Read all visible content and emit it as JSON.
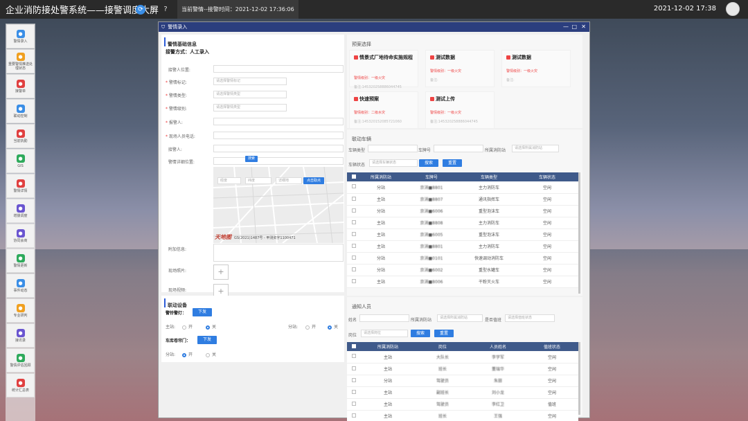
{
  "topbar": {
    "title": "企业消防接处警系统——接警调度大屏",
    "alarm_text": "当前警情--接警时间：2021-12-02 17:36:06",
    "datetime": "2021-12-02 17:38",
    "icons": [
      "refresh-icon",
      "wave-icon",
      "help-icon"
    ]
  },
  "sidebar": {
    "items": [
      {
        "label": "警情录入",
        "color": "#3a8ee6",
        "icon": "pencil-icon"
      },
      {
        "label": "重要警情推送处理状态",
        "color": "#f0a020",
        "icon": "bell-icon"
      },
      {
        "label": "接警单",
        "color": "#e04040",
        "icon": "alert-icon"
      },
      {
        "label": "联动控制",
        "color": "#3a8ee6",
        "icon": "link-icon"
      },
      {
        "label": "当前执勤",
        "color": "#e04040",
        "icon": "duty-icon"
      },
      {
        "label": "GIS",
        "color": "#2eaa5c",
        "icon": "pin-icon"
      },
      {
        "label": "警情详情",
        "color": "#e04040",
        "icon": "detail-icon"
      },
      {
        "label": "增援调度",
        "color": "#6a55d0",
        "icon": "dispatch-icon"
      },
      {
        "label": "协同会商",
        "color": "#6a55d0",
        "icon": "meeting-icon"
      },
      {
        "label": "警情更新",
        "color": "#2eaa5c",
        "icon": "update-icon"
      },
      {
        "label": "事件动态",
        "color": "#3a8ee6",
        "icon": "event-icon"
      },
      {
        "label": "专业研判",
        "color": "#f0a020",
        "icon": "study-icon"
      },
      {
        "label": "接讯录",
        "color": "#6a55d0",
        "icon": "contact-icon"
      },
      {
        "label": "警情评估回顾",
        "color": "#2eaa5c",
        "icon": "review-icon"
      },
      {
        "label": "统计汇总表",
        "color": "#e04040",
        "icon": "stats-icon"
      }
    ]
  },
  "dialog": {
    "title": "警情录入",
    "controls": [
      "—",
      "□",
      "✕"
    ],
    "basic": {
      "section": "警情基础信息",
      "method": "接警方式：人工录入",
      "fields": [
        {
          "label": "接警人位置:",
          "required": false,
          "placeholder": ""
        },
        {
          "label": "警情标记:",
          "required": true,
          "placeholder": "请选择警情标记"
        },
        {
          "label": "警情类型:",
          "required": true,
          "placeholder": "请选择警情类型"
        },
        {
          "label": "警情级别:",
          "required": true,
          "placeholder": "请选择警情类型"
        },
        {
          "label": "报警人:",
          "required": true,
          "placeholder": ""
        },
        {
          "label": "现场人员电话:",
          "required": true,
          "placeholder": ""
        },
        {
          "label": "接警人:",
          "required": false,
          "placeholder": ""
        },
        {
          "label": "警情详细位置:",
          "required": false,
          "placeholder": ""
        }
      ],
      "search_btn": "搜索",
      "map_inputs": [
        "经度",
        "纬度",
        "详细地"
      ],
      "map_click_btn": "点击取点",
      "map_logo": "天地图",
      "map_license": "GS(2021)1487号 - 甲测资字1100471",
      "extra_label": "附加信息:",
      "photo_label": "现场照片:",
      "video_label": "现场视频:"
    },
    "devices": {
      "section": "联动设备",
      "alarm_bell": "警铃警灯：",
      "issue_btn": "下发",
      "main_station": "主站:",
      "sub_station": "分站:",
      "on": "开",
      "off": "关",
      "garage": "车库卷帘门：",
      "garage_btn": "下发"
    },
    "plan": {
      "section": "预案选择",
      "cards": [
        {
          "title": "情景式厂地待命实施规程",
          "level": "警情级别：一级火灾",
          "note": "备注:145320258886044745"
        },
        {
          "title": "测试数据",
          "level": "警情级别：一级火灾",
          "note": "备注:"
        },
        {
          "title": "测试数据",
          "level": "警情级别：一级火灾",
          "note": "备注:"
        },
        {
          "title": "快速预案",
          "level": "警情级别：二级水灾",
          "note": "备注:145320152085721060"
        },
        {
          "title": "测试上传",
          "level": "警情级别：一级火灾",
          "note": "备注:145320258886044745"
        }
      ]
    },
    "vehicles": {
      "section": "联动车辆",
      "filter_type": "车辆类型",
      "filter_plate": "车牌号",
      "filter_station": "所属消防站",
      "filter_station_ph": "请选择所属消防站",
      "filter_status": "车辆状态",
      "filter_status_ph": "请选择车辆状态",
      "search_btn": "搜索",
      "reset_btn": "重置",
      "headers": [
        "所属消防站",
        "车牌号",
        "车辆类型",
        "车辆状态"
      ],
      "rows": [
        [
          "分站",
          "京消■8801",
          "主力消防车",
          "空闲"
        ],
        [
          "主站",
          "京消■8807",
          "通讯指挥车",
          "空闲"
        ],
        [
          "分站",
          "京消■6006",
          "重型泡沫车",
          "空闲"
        ],
        [
          "主站",
          "京消■8808",
          "主力消防车",
          "空闲"
        ],
        [
          "主站",
          "京消■6005",
          "重型泡沫车",
          "空闲"
        ],
        [
          "主站",
          "京消■8801",
          "主力消防车",
          "空闲"
        ],
        [
          "分站",
          "京消■0101",
          "快速调动消防车",
          "空闲"
        ],
        [
          "分站",
          "京消■6002",
          "重型水罐车",
          "空闲"
        ],
        [
          "主站",
          "京消■8006",
          "干粉灭火车",
          "空闲"
        ]
      ]
    },
    "notify": {
      "section": "通知人员",
      "filter_name": "姓名",
      "filter_station": "所属消防站",
      "filter_station_ph": "请选择所属消防站",
      "filter_duty": "是否值班",
      "filter_duty_ph": "请选择值班状态",
      "filter_post": "岗位",
      "filter_post_ph": "请选择岗位",
      "search_btn": "搜索",
      "reset_btn": "重置",
      "headers": [
        "所属消防站",
        "岗位",
        "人员姓名",
        "值班状态"
      ],
      "rows": [
        [
          "主站",
          "大队长",
          "李学军",
          "空闲"
        ],
        [
          "主站",
          "班长",
          "董瑞华",
          "空闲"
        ],
        [
          "分站",
          "驾驶员",
          "朱丽",
          "空闲"
        ],
        [
          "主站",
          "副班长",
          "刘小龙",
          "空闲"
        ],
        [
          "主站",
          "驾驶员",
          "李红卫",
          "值班"
        ],
        [
          "主站",
          "班长",
          "王强",
          "空闲"
        ]
      ]
    }
  }
}
